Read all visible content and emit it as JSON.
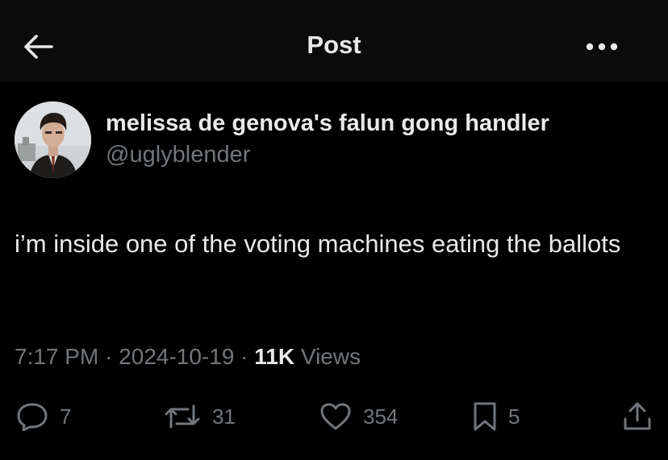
{
  "header": {
    "title": "Post",
    "back_icon": "arrow-left-icon",
    "more_icon": "more-horizontal-icon"
  },
  "author": {
    "display_name": "melissa de genova's falun gong handler",
    "handle": "@uglyblender"
  },
  "post": {
    "text": "i’m inside one of the voting machines eating the ballots"
  },
  "meta": {
    "time": "7:17 PM",
    "sep1": " · ",
    "date": "2024-10-19",
    "sep2": " · ",
    "views_count": "11K",
    "views_label": " Views"
  },
  "actions": {
    "replies": "7",
    "reposts": "31",
    "likes": "354",
    "bookmarks": "5"
  },
  "colors": {
    "background": "#000000",
    "header_background": "#0b0b0b",
    "primary_text": "#e7e9ea",
    "secondary_text": "#71767b"
  }
}
